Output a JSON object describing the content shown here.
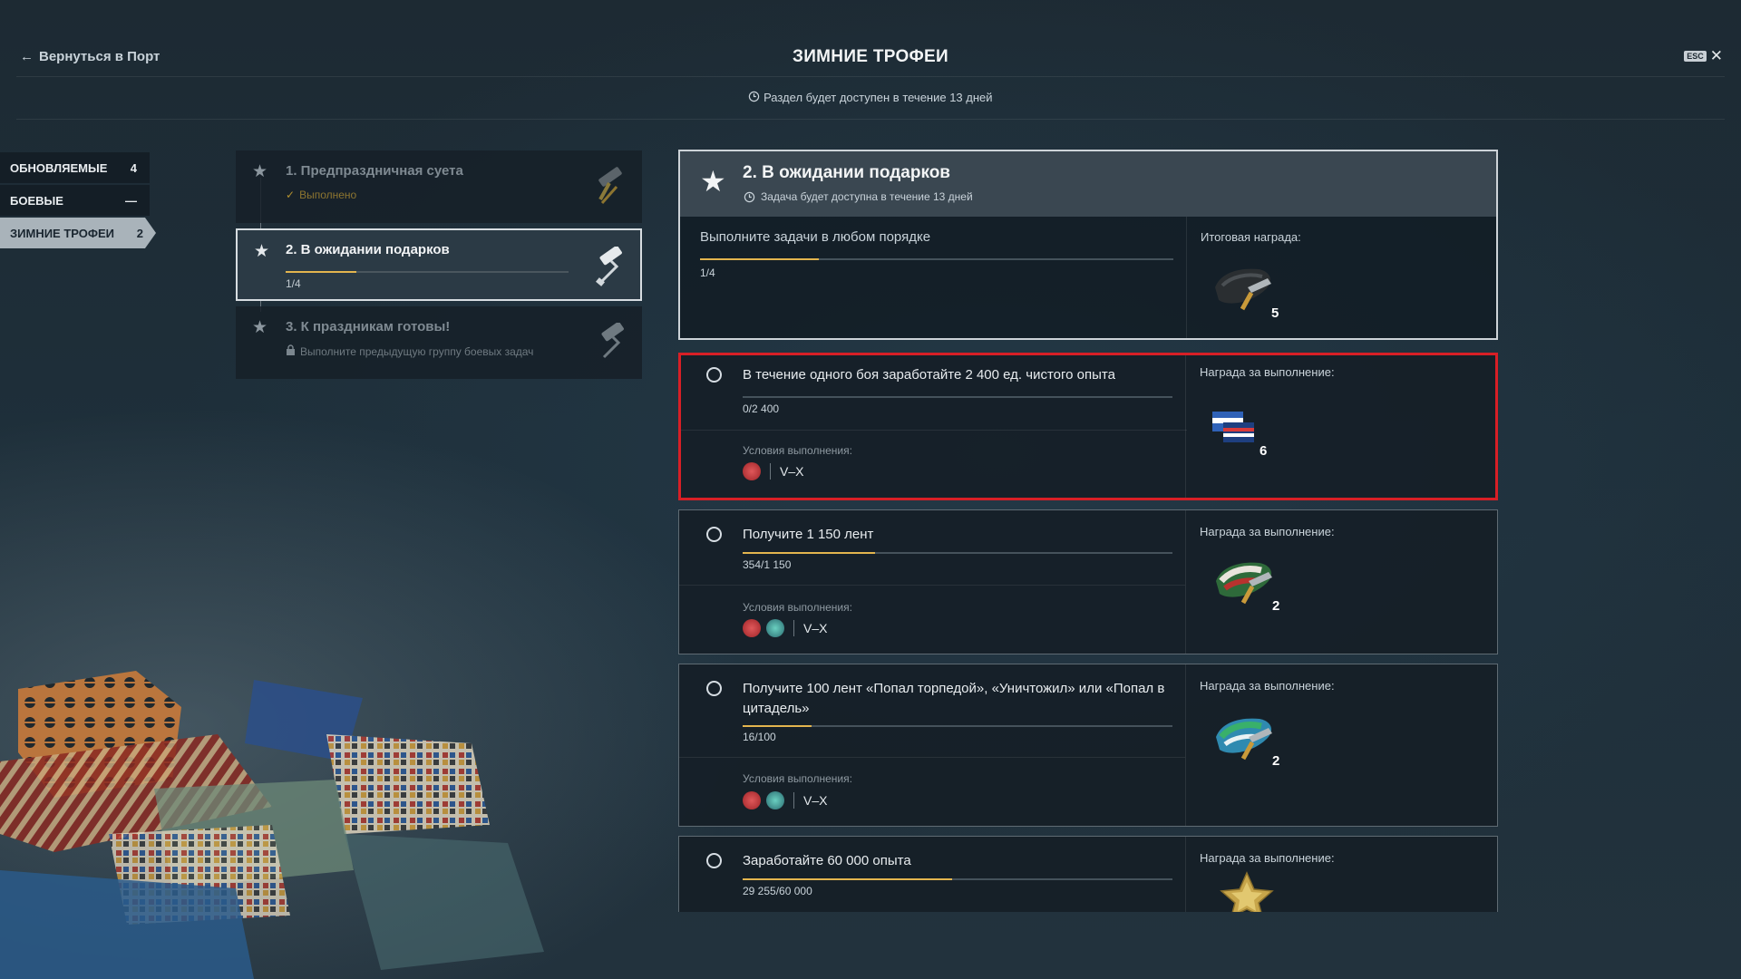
{
  "header": {
    "back_label": "Вернуться в Порт",
    "title": "ЗИМНИЕ ТРОФЕИ",
    "availability": "Раздел будет доступен в течение 13 дней",
    "esc_label": "ESC"
  },
  "sidebar": {
    "items": [
      {
        "label": "ОБНОВЛЯЕМЫЕ",
        "count": "4"
      },
      {
        "label": "БОЕВЫЕ",
        "count": "—"
      },
      {
        "label": "ЗИМНИЕ ТРОФЕИ",
        "count": "2"
      }
    ]
  },
  "quests": [
    {
      "title": "1. Предпраздничная суета",
      "status": "Выполнено"
    },
    {
      "title": "2. В ожидании подарков",
      "progress_text": "1/4",
      "progress": 0.25
    },
    {
      "title": "3. К праздникам готовы!",
      "status": "Выполните предыдущую группу боевых задач"
    }
  ],
  "detail": {
    "title": "2. В ожидании подарков",
    "availability": "Задача будет доступна в течение 13 дней",
    "instruction": "Выполните задачи в любом порядке",
    "progress_text": "1/4",
    "progress": 0.25,
    "reward_label": "Итоговая награда:",
    "reward_count": "5"
  },
  "tasks": [
    {
      "title": "В течение одного боя заработайте 2 400 ед. чистого опыта",
      "progress_text": "0/2 400",
      "progress": 0,
      "conditions_label": "Условия выполнения:",
      "tiers": "V–X",
      "reward_label": "Награда за выполнение:",
      "reward_count": "6"
    },
    {
      "title": "Получите 1 150 лент",
      "progress_text": "354/1 150",
      "progress": 0.308,
      "conditions_label": "Условия выполнения:",
      "tiers": "V–X",
      "reward_label": "Награда за выполнение:",
      "reward_count": "2"
    },
    {
      "title": "Получите 100 лент «Попал торпедой», «Уничтожил» или «Попал в цитадель»",
      "progress_text": "16/100",
      "progress": 0.16,
      "conditions_label": "Условия выполнения:",
      "tiers": "V–X",
      "reward_label": "Награда за выполнение:",
      "reward_count": "2"
    },
    {
      "title": "Заработайте 60 000 опыта",
      "progress_text": "29 255/60 000",
      "progress": 0.488,
      "reward_label": "Награда за выполнение:"
    }
  ],
  "colors": {
    "accent": "#e3b54e",
    "highlight": "#d81f26"
  }
}
